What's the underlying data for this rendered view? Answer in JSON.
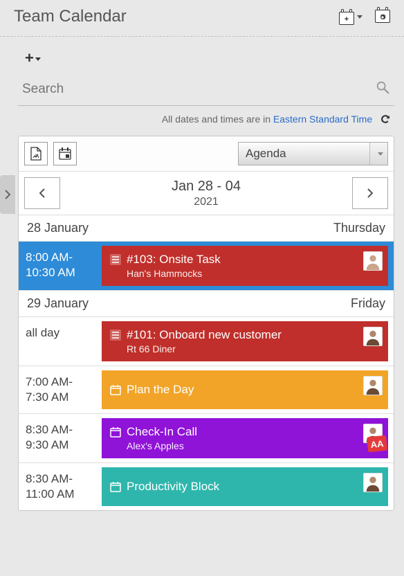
{
  "header": {
    "title": "Team Calendar"
  },
  "search": {
    "placeholder": "Search"
  },
  "timezone": {
    "prefix": "All dates and times are in ",
    "link": "Eastern Standard Time"
  },
  "view": {
    "selected": "Agenda"
  },
  "dateRange": {
    "range": "Jan 28 - 04",
    "year": "2021"
  },
  "days": [
    {
      "date": "28 January",
      "weekday": "Thursday"
    },
    {
      "date": "29 January",
      "weekday": "Friday"
    }
  ],
  "events": [
    {
      "time": "8:00 AM-10:30 AM",
      "title": "#103: Onsite Task",
      "sub": "Han's Hammocks",
      "color": "c-red",
      "icon": "list",
      "selected": true
    },
    {
      "time": "all day",
      "title": "#101: Onboard new customer",
      "sub": "Rt 66 Diner",
      "color": "c-red",
      "icon": "list"
    },
    {
      "time": "7:00 AM-7:30 AM",
      "title": "Plan the Day",
      "sub": "",
      "color": "c-orange",
      "icon": "cal"
    },
    {
      "time": "8:30 AM-9:30 AM",
      "title": "Check-In Call",
      "sub": "Alex's Apples",
      "color": "c-purple",
      "icon": "cal",
      "badge": "AA"
    },
    {
      "time": "8:30 AM-11:00 AM",
      "title": "Productivity Block",
      "sub": "",
      "color": "c-teal",
      "icon": "cal"
    }
  ]
}
